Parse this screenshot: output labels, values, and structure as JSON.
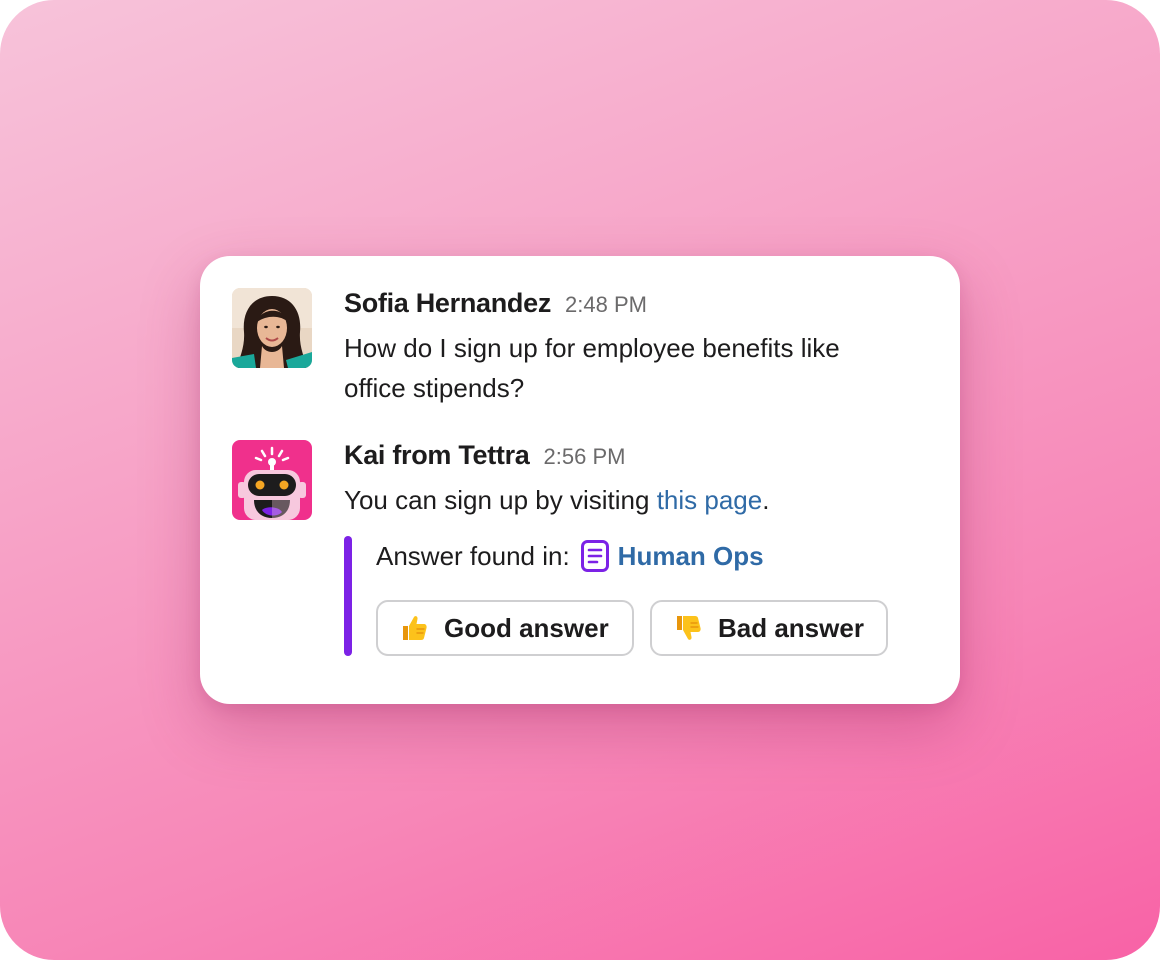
{
  "messages": [
    {
      "author": "Sofia Hernandez",
      "time": "2:48 PM",
      "text": "How do I sign up for employee benefits like office stipends?",
      "avatar_icon": "user-photo-avatar"
    },
    {
      "author": "Kai from Tettra",
      "time": "2:56 PM",
      "text_before_link": "You can sign up by visiting ",
      "link_text": "this page",
      "text_after_link": ".",
      "avatar_icon": "robot-avatar"
    }
  ],
  "attachment": {
    "found_label": "Answer found in:",
    "source_icon": "document-icon",
    "source_name": "Human Ops",
    "accent_color": "#7c22e6"
  },
  "feedback": {
    "good_label": "Good answer",
    "good_icon": "thumbs-up-icon",
    "bad_label": "Bad answer",
    "bad_icon": "thumbs-down-icon"
  },
  "colors": {
    "link": "#2f6aa6",
    "background_start": "#f7c3da",
    "background_end": "#f862a6",
    "robot_bg": "#f0308c"
  }
}
